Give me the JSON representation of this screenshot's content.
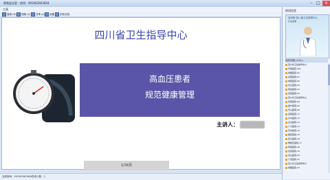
{
  "window": {
    "title": "视频会议室 - 房间：993462603604"
  },
  "menu": {
    "items": [
      "工具"
    ]
  },
  "toolbar": {
    "items": [
      "音频 (M)",
      "视频 (V)",
      "共享 (S)",
      "设置",
      "浏览文档"
    ]
  },
  "slide": {
    "title": "四川省卫生指导中心",
    "box_line1": "高血压患者",
    "box_line2": "规范健康管理",
    "speaker_label": "主讲人："
  },
  "pager": {
    "text": "1/34页"
  },
  "status": {
    "left": "当前房间：993462603604",
    "right": "在线人数：2"
  },
  "right_panel": {
    "header": "房间信息",
    "video_caption": "自然家    四川省卫生指导中心",
    "video_sub": "正在讲课",
    "list_title": "成员列表 (14人)",
    "members": [
      "四川省卫生指导中心",
      "华西医院 001",
      "成都医院-02",
      "资阳医院-01",
      "绵阳医院-05",
      "内江医院-03",
      "南充医院-07",
      "自贡医院-04",
      "四川省卫生指导中心",
      "德阳医院-06",
      "遂宁医院-09",
      "乐山医院-08",
      "宜宾医院-11",
      "泸州医院-10",
      "达州医院-12",
      "广元医院-13",
      "巴中医院-14",
      "雅安医院-15",
      "眉山医院-16",
      "攀枝花医院-17",
      "阿坝医院-18",
      "甘孜医院-19",
      "凉山医院-20",
      "广安医院-21",
      "四川省卫生指导中心",
      "成都医院-22"
    ]
  },
  "colors": {
    "title_blue": "#3a46a8",
    "box_purple": "#5a55a8",
    "close_red": "#d9534f"
  }
}
